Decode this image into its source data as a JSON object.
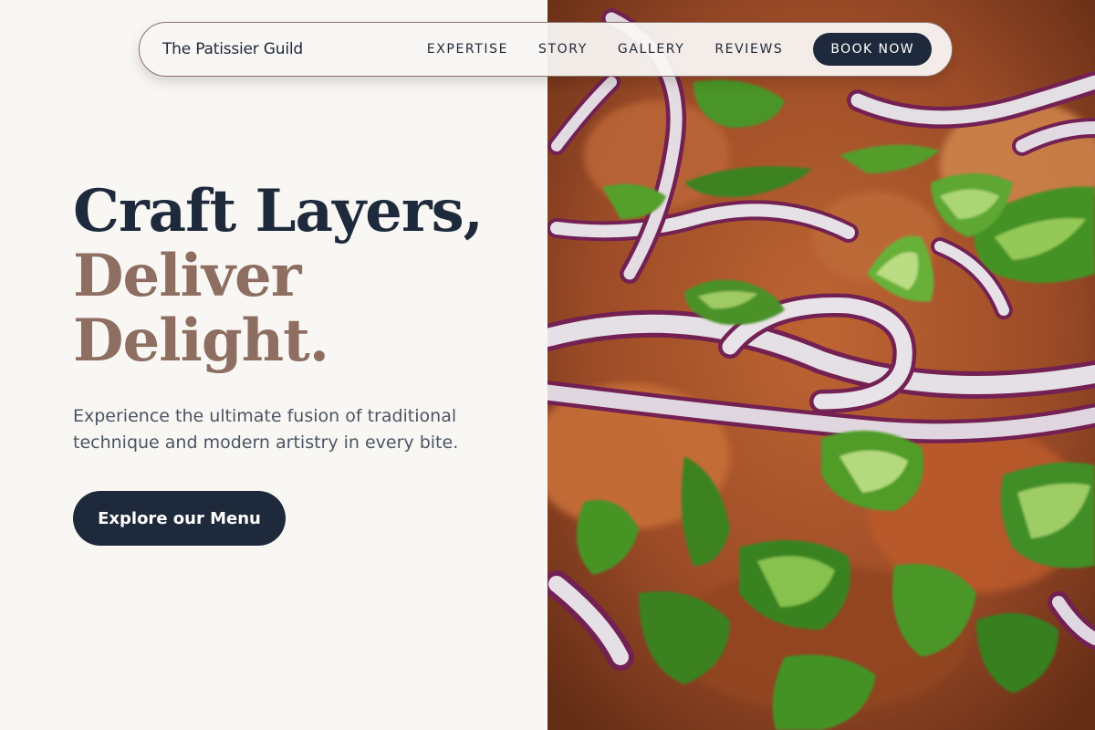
{
  "nav": {
    "brand": "The Patissier Guild",
    "links": [
      "EXPERTISE",
      "STORY",
      "GALLERY",
      "REVIEWS"
    ],
    "cta": "BOOK NOW"
  },
  "hero": {
    "headline_line1": "Craft Layers,",
    "headline_line2": "Deliver",
    "headline_line3": "Delight.",
    "subtitle": "Experience the ultimate fusion of traditional technique and modern artistry in every bite.",
    "cta": "Explore our Menu",
    "image": "food-closeup-photo"
  },
  "colors": {
    "primary": "#1e293b",
    "accent": "#8f6e62",
    "background": "#f9f7f4",
    "text_muted": "#4b5563"
  }
}
